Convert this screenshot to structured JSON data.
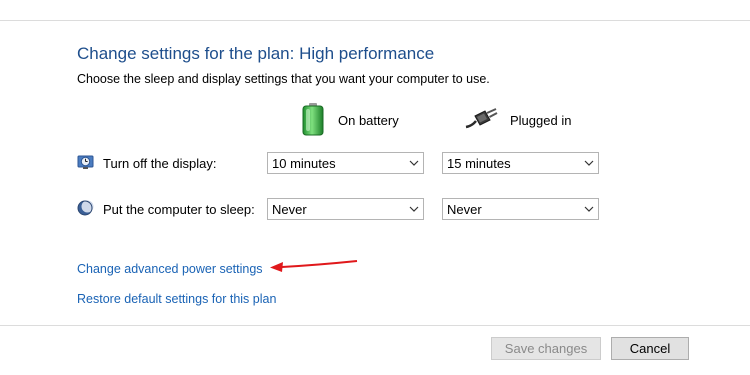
{
  "header": {
    "title": "Change settings for the plan: High performance",
    "subtitle": "Choose the sleep and display settings that you want your computer to use."
  },
  "columns": {
    "battery": {
      "label": "On battery",
      "icon": "battery-icon"
    },
    "plugged": {
      "label": "Plugged in",
      "icon": "power-plug-icon"
    }
  },
  "rows": [
    {
      "label": "Turn off the display:",
      "icon": "monitor-clock-icon",
      "battery_value": "10 minutes",
      "plugged_value": "15 minutes"
    },
    {
      "label": "Put the computer to sleep:",
      "icon": "moon-sleep-icon",
      "battery_value": "Never",
      "plugged_value": "Never"
    }
  ],
  "links": {
    "advanced": "Change advanced power settings",
    "restore": "Restore default settings for this plan"
  },
  "buttons": {
    "save": "Save changes",
    "cancel": "Cancel"
  },
  "colors": {
    "title": "#1e4e8c",
    "link": "#1a63b5",
    "annotation_arrow": "#e0181b",
    "battery_green": "#3bb54a"
  }
}
